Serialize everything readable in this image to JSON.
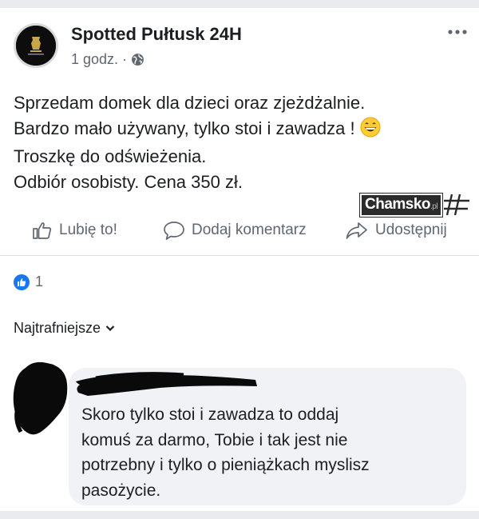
{
  "post": {
    "page_name": "Spotted Pułtusk 24H",
    "time": "1 godz.",
    "separator": "·",
    "privacy_icon": "globe-icon",
    "more_icon": "more-horizontal-icon",
    "text_lines": [
      "Sprzedam domek dla dzieci oraz  zjeżdżalnie.",
      "Bardzo mało używany, tylko stoi i zawadza !",
      "Troszkę do odświeżenia.",
      "Odbiór osobisty. Cena 350 zł."
    ],
    "emoji": "grinning-face-emoji"
  },
  "watermark": {
    "text": "Chamsko",
    "suffix": ".pl"
  },
  "actions": {
    "like": {
      "label": "Lubię to!",
      "icon": "thumbs-up-icon"
    },
    "comment": {
      "label": "Dodaj komentarz",
      "icon": "comment-bubble-icon"
    },
    "share": {
      "label": "Udostępnij",
      "icon": "share-arrow-icon"
    }
  },
  "reactions": {
    "count": "1",
    "icon": "like-reaction-icon",
    "color": "#1877f2"
  },
  "comments_sort": {
    "label": "Najtrafniejsze",
    "icon": "chevron-down-icon"
  },
  "comment": {
    "text_lines": [
      "Skoro tylko stoi i zawadza to oddaj",
      "komuś za darmo, Tobie i tak jest nie",
      "potrzebny i tylko o pieniążkach myslisz",
      "pasożycie."
    ]
  },
  "colors": {
    "text_primary": "#1c1e21",
    "text_secondary": "#606770",
    "bubble": "#f0f2f5",
    "accent": "#1877f2"
  }
}
